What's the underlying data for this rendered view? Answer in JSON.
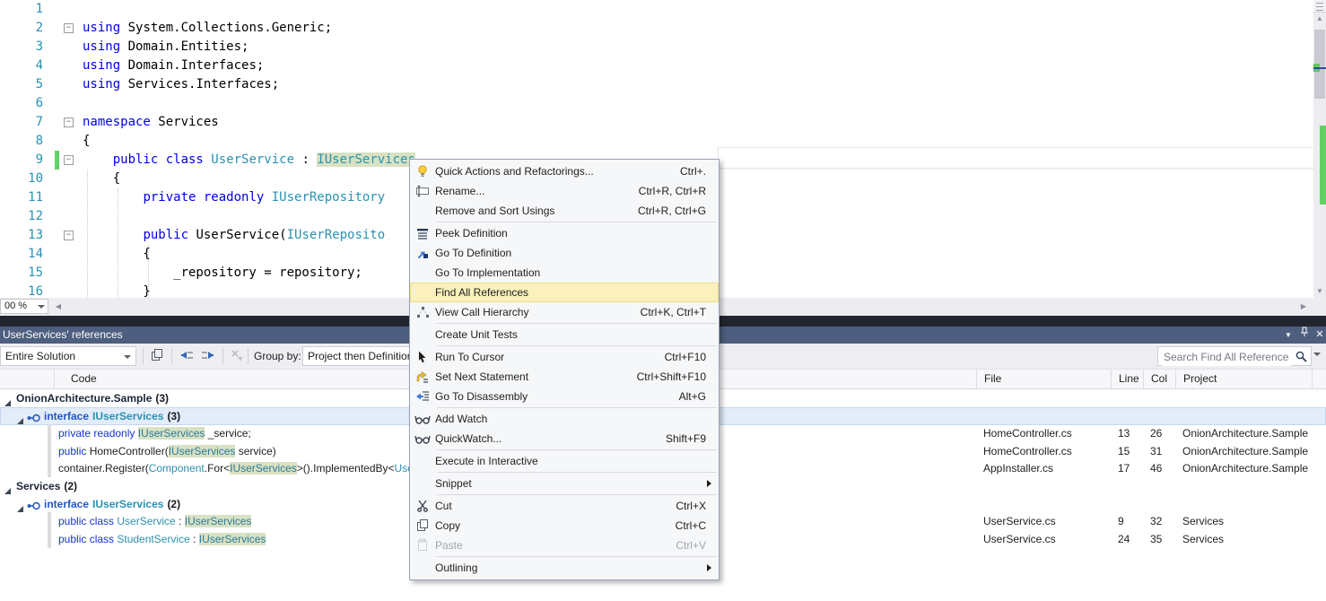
{
  "editor": {
    "zoom_value": "00 %",
    "lines": [
      {
        "n": "1",
        "segs": []
      },
      {
        "n": "2",
        "fold": true,
        "segs": [
          [
            "kw",
            "using"
          ],
          [
            "pl",
            " System.Collections.Generic;"
          ]
        ]
      },
      {
        "n": "3",
        "segs": [
          [
            "kw",
            "using"
          ],
          [
            "pl",
            " Domain.Entities;"
          ]
        ]
      },
      {
        "n": "4",
        "segs": [
          [
            "kw",
            "using"
          ],
          [
            "pl",
            " Domain.Interfaces;"
          ]
        ]
      },
      {
        "n": "5",
        "segs": [
          [
            "kw",
            "using"
          ],
          [
            "pl",
            " Services.Interfaces;"
          ]
        ]
      },
      {
        "n": "6",
        "segs": []
      },
      {
        "n": "7",
        "fold": true,
        "segs": [
          [
            "kw",
            "namespace"
          ],
          [
            "pl",
            " Services"
          ]
        ]
      },
      {
        "n": "8",
        "segs": [
          [
            "pl",
            "{"
          ]
        ]
      },
      {
        "n": "9",
        "fold": true,
        "changed": true,
        "segs": [
          [
            "pl",
            "    "
          ],
          [
            "kw",
            "public class"
          ],
          [
            "ty",
            " UserService"
          ],
          [
            "pl",
            " : "
          ],
          [
            "hl",
            "IUserServices"
          ]
        ]
      },
      {
        "n": "10",
        "segs": [
          [
            "pl",
            "    {"
          ]
        ]
      },
      {
        "n": "11",
        "segs": [
          [
            "pl",
            "        "
          ],
          [
            "kw",
            "private readonly"
          ],
          [
            "ty",
            " IUserRepository"
          ]
        ]
      },
      {
        "n": "12",
        "segs": []
      },
      {
        "n": "13",
        "fold": true,
        "segs": [
          [
            "pl",
            "        "
          ],
          [
            "kw",
            "public"
          ],
          [
            "pl",
            " UserService("
          ],
          [
            "ty",
            "IUserReposito"
          ]
        ]
      },
      {
        "n": "14",
        "segs": [
          [
            "pl",
            "        {"
          ]
        ]
      },
      {
        "n": "15",
        "segs": [
          [
            "pl",
            "            _repository = repository;"
          ]
        ]
      },
      {
        "n": "16",
        "segs": [
          [
            "pl",
            "        }"
          ]
        ]
      }
    ]
  },
  "context_menu": {
    "items": [
      {
        "icon": "lightbulb",
        "label": "Quick Actions and Refactorings...",
        "shortcut": "Ctrl+."
      },
      {
        "icon": "rename",
        "label": "Rename...",
        "shortcut": "Ctrl+R, Ctrl+R"
      },
      {
        "label": "Remove and Sort Usings",
        "shortcut": "Ctrl+R, Ctrl+G"
      },
      {
        "sep": true
      },
      {
        "icon": "peek",
        "label": "Peek Definition"
      },
      {
        "icon": "gotodef",
        "label": "Go To Definition"
      },
      {
        "label": "Go To Implementation"
      },
      {
        "label": "Find All References",
        "highlighted": true
      },
      {
        "icon": "callhier",
        "label": "View Call Hierarchy",
        "shortcut": "Ctrl+K, Ctrl+T"
      },
      {
        "sep": true
      },
      {
        "label": "Create Unit Tests"
      },
      {
        "sep": true
      },
      {
        "icon": "cursor",
        "label": "Run To Cursor",
        "shortcut": "Ctrl+F10"
      },
      {
        "icon": "setnext",
        "label": "Set Next Statement",
        "shortcut": "Ctrl+Shift+F10"
      },
      {
        "icon": "disasm",
        "label": "Go To Disassembly",
        "shortcut": "Alt+G"
      },
      {
        "sep": true
      },
      {
        "icon": "glasses",
        "label": "Add Watch"
      },
      {
        "icon": "glasses",
        "label": "QuickWatch...",
        "shortcut": "Shift+F9"
      },
      {
        "sep": true
      },
      {
        "label": "Execute in Interactive"
      },
      {
        "sep": true
      },
      {
        "label": "Snippet",
        "submenu": true
      },
      {
        "sep": true
      },
      {
        "icon": "scissors",
        "label": "Cut",
        "shortcut": "Ctrl+X"
      },
      {
        "icon": "copy",
        "label": "Copy",
        "shortcut": "Ctrl+C"
      },
      {
        "icon": "paste",
        "label": "Paste",
        "shortcut": "Ctrl+V",
        "disabled": true
      },
      {
        "sep": true
      },
      {
        "label": "Outlining",
        "submenu": true
      }
    ]
  },
  "references": {
    "title": "UserServices' references",
    "toolbar": {
      "scope": "Entire Solution",
      "group_by_label": "Group by:",
      "group_by_value": "Project then Definition",
      "search_placeholder": "Search Find All References"
    },
    "columns": [
      "",
      "Code",
      "File",
      "Line",
      "Col",
      "Project",
      ""
    ],
    "rows": [
      {
        "type": "group",
        "label": "OnionArchitecture.Sample",
        "count": "(3)"
      },
      {
        "type": "iface",
        "kw": "interface",
        "name": "IUserServices",
        "count": "(3)",
        "selected": true
      },
      {
        "type": "code",
        "segs": [
          [
            "kw",
            "private readonly "
          ],
          [
            "hl",
            "IUserServices"
          ],
          [
            "pl",
            " _service;"
          ]
        ],
        "file": "HomeController.cs",
        "line": "13",
        "col": "26",
        "project": "OnionArchitecture.Sample"
      },
      {
        "type": "code",
        "segs": [
          [
            "kw",
            "public "
          ],
          [
            "pl",
            "HomeController("
          ],
          [
            "hl",
            "IUserServices"
          ],
          [
            "pl",
            " service)"
          ]
        ],
        "file": "HomeController.cs",
        "line": "15",
        "col": "31",
        "project": "OnionArchitecture.Sample"
      },
      {
        "type": "code",
        "segs": [
          [
            "pl",
            "container.Register("
          ],
          [
            "ty",
            "Component"
          ],
          [
            "pl",
            ".For<"
          ],
          [
            "hl",
            "IUserServices"
          ],
          [
            "pl",
            ">().ImplementedBy<"
          ],
          [
            "ty",
            "Use"
          ]
        ],
        "file": "AppInstaller.cs",
        "line": "17",
        "col": "46",
        "project": "OnionArchitecture.Sample"
      },
      {
        "type": "group",
        "label": "Services",
        "count": "(2)"
      },
      {
        "type": "iface",
        "kw": "interface",
        "name": "IUserServices",
        "count": "(2)"
      },
      {
        "type": "code",
        "segs": [
          [
            "kw",
            "public class "
          ],
          [
            "ty",
            "UserService"
          ],
          [
            "pl",
            " : "
          ],
          [
            "hl",
            "IUserServices"
          ]
        ],
        "file": "UserService.cs",
        "line": "9",
        "col": "32",
        "project": "Services"
      },
      {
        "type": "code",
        "segs": [
          [
            "kw",
            "public class "
          ],
          [
            "ty",
            "StudentService"
          ],
          [
            "pl",
            " : "
          ],
          [
            "hl",
            "IUserServices"
          ]
        ],
        "file": "UserService.cs",
        "line": "24",
        "col": "35",
        "project": "Services"
      }
    ]
  },
  "colors": {
    "titlebar": "#4d5e7e",
    "keyword_blue": "#0000e6",
    "type_teal": "#2b91af",
    "reference_highlight": "#d8e2c3",
    "menu_highlight": "#fbf1bc",
    "change_bar_green": "#5fd463"
  }
}
